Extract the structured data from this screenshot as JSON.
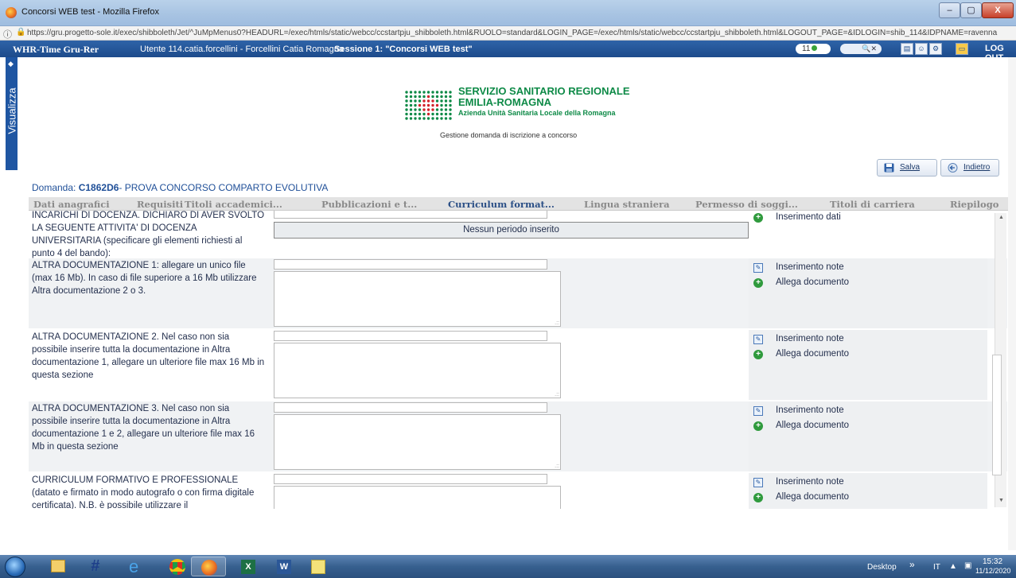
{
  "window": {
    "title": "Concorsi WEB test - Mozilla Firefox",
    "controls": [
      "–",
      "▢",
      "X"
    ]
  },
  "url": "https://gru.progetto-sole.it/exec/shibboleth/Jet/^JuMpMenus0?HEADURL=/exec/htmls/static/webcc/ccstartpju_shibboleth.html&RUOLO=standard&LOGIN_PAGE=/exec/htmls/static/webcc/ccstartpju_shibboleth.html&LOGOUT_PAGE=&IDLOGIN=shib_114&IDPNAME=ravenna",
  "appbar": {
    "app_name": "WHR-Time Gru-Rer",
    "user": "Utente 114.catia.forcellini - Forcellini Catia Romagna",
    "session": "Sessione 1: \"Concorsi WEB test\"",
    "counter": "11",
    "logout": "LOG OUT"
  },
  "sidetab": {
    "label": "Visualizza"
  },
  "logo": {
    "line1": "SERVIZIO SANITARIO REGIONALE",
    "line2": "EMILIA-ROMAGNA",
    "line3": "Azienda Unità Sanitaria Locale della Romagna",
    "color": "#0e8a47"
  },
  "subtitle": "Gestione domanda di iscrizione a concorso",
  "buttons": {
    "salva": "Salva",
    "indietro": "Indietro"
  },
  "domanda": {
    "prefix": "Domanda:",
    "code": "C1862D6",
    "rest": "- PROVA CONCORSO COMPARTO EVOLUTIVA"
  },
  "tabs": [
    "Dati anagrafici",
    "Requisiti",
    "Titoli accademici...",
    "Pubblicazioni e t...",
    "Curriculum format...",
    "Lingua straniera",
    "Permesso di soggi...",
    "Titoli di carriera",
    "Riepilogo"
  ],
  "active_tab": "Curriculum format...",
  "rows": [
    {
      "desc": "INCARICHI DI DOCENZA. DICHIARO DI AVER SVOLTO LA SEGUENTE ATTIVITA' DI DOCENZA UNIVERSITARIA (specificare gli elementi richiesti al punto 4 del bando):",
      "empty_message": "Nessun periodo inserito",
      "action1": "Inserimento dati"
    },
    {
      "desc": "ALTRA DOCUMENTAZIONE 1: allegare un unico file (max 16 Mb). In caso di file superiore a 16 Mb utilizzare Altra documentazione 2 o 3.",
      "action1": "Inserimento note",
      "action2": "Allega documento"
    },
    {
      "desc": "ALTRA DOCUMENTAZIONE 2. Nel caso non sia possibile inserire tutta la documentazione in Altra documentazione 1, allegare un ulteriore file max 16 Mb in questa sezione",
      "action1": "Inserimento note",
      "action2": "Allega documento"
    },
    {
      "desc": "ALTRA DOCUMENTAZIONE 3. Nel caso non sia possibile inserire tutta la documentazione in Altra documentazione 1 e 2, allegare un ulteriore file max 16 Mb in questa sezione",
      "action1": "Inserimento note",
      "action2": "Allega documento"
    },
    {
      "desc": "CURRICULUM FORMATIVO E PROFESSIONALE (datato e firmato in modo autografo o con firma digitale certificata). N.B. è possibile utilizzare il",
      "action1": "Inserimento note",
      "action2": "Allega documento"
    }
  ],
  "taskbar": {
    "apps": [
      "explorer-icon",
      "file-manager-icon",
      "h-app-icon",
      "internet-explorer-icon",
      "chrome-icon",
      "firefox-icon",
      "excel-icon",
      "word-icon",
      "sticky-app-icon"
    ],
    "desktop_label": "Desktop",
    "lang": "IT",
    "time": "15:32",
    "date": "11/12/2020"
  },
  "colors": {
    "app_header": "#1d4b8b",
    "tab_active": "#2b4f86",
    "tab_inactive": "#8a8a8a",
    "plus_icon": "#2f9a3d"
  }
}
